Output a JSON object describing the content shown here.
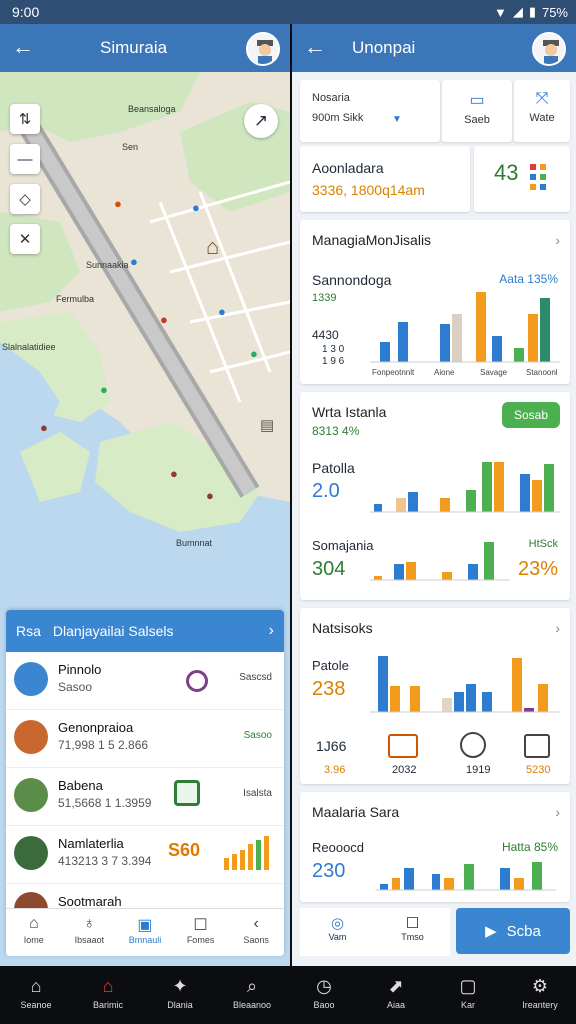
{
  "status": {
    "time": "9:00",
    "battery": "75%"
  },
  "left": {
    "title": "Simuraia",
    "map_labels": [
      "Beansaloga",
      "Sen",
      "Sunnaakia",
      "Fermulba",
      "Slalnalatidiee",
      "Bumnnat"
    ],
    "card": {
      "short": "Rsa",
      "title": "Dlanjayailai Salsels",
      "items": [
        {
          "name": "Pinnolo",
          "sub": "Sasoo",
          "right": "Sascsd"
        },
        {
          "name": "Genonpraioa",
          "sub": "71,998 1 5 2.866",
          "right": "Sasoo"
        },
        {
          "name": "Babena",
          "sub": "51,5668 1 1.3959",
          "right": "Isalsta"
        },
        {
          "name": "Namlaterlia",
          "sub": "413213 3 7 3.394",
          "right": "S60"
        },
        {
          "name": "Sootmarah",
          "sub": "",
          "right": ""
        }
      ],
      "tabs": [
        "Iome",
        "Ibsaaot",
        "Bmnauli",
        "Fomes",
        "Saons"
      ]
    }
  },
  "right": {
    "title": "Unonpai",
    "top_card": {
      "label": "Nosaria",
      "value": "900m Sikk",
      "btn1": "Saeb",
      "btn2": "Wate"
    },
    "second_card": {
      "label": "Aoonladara",
      "value": "3336, 1800q14am",
      "number": "43"
    },
    "card3": {
      "title": "ManagiaMonJisalis",
      "sub": "Sannondoga",
      "tag": "Aata 135%",
      "n1": "1339",
      "n2": "4430",
      "n3": "1 3 0",
      "n4": "1 9 6",
      "cats": [
        "Fonpeotnnlt",
        "Aione",
        "Savage",
        "Stanoonl"
      ]
    },
    "card4": {
      "title": "Wrta Istanla",
      "sub": "8313 4%",
      "chip": "Sosab",
      "label1": "Patolla",
      "val1": "2.0",
      "label2": "Somajania",
      "val2": "304",
      "tag2": "HtSck",
      "pct": "23%"
    },
    "card5": {
      "title": "Natsisoks",
      "label": "Patole",
      "val": "238",
      "n1": "1J66",
      "icons": [
        "3.96",
        "2032",
        "1919",
        "5230"
      ]
    },
    "card6": {
      "title": "Maalaria Sara",
      "label": "Reooocd",
      "val": "230",
      "tag": "Hatta 85%"
    },
    "tabs": [
      "Vam",
      "Tmso"
    ],
    "play": "Scba"
  },
  "sysnav": [
    "Seanoe",
    "Barimic",
    "Dlania",
    "Bleaanoo",
    "Baoo",
    "Aiaa",
    "Kar",
    "Ireantery"
  ],
  "colors": {
    "primary": "#3a86d0",
    "appbar": "#3a76b8",
    "green": "#4caf50",
    "orange": "#f29b1d",
    "blue": "#2e7ccf"
  }
}
